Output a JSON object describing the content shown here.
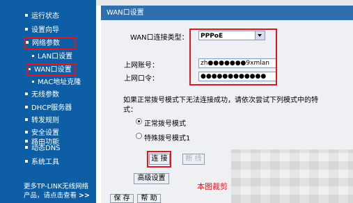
{
  "sidebar": {
    "items": [
      {
        "label": "运行状态",
        "level": "top"
      },
      {
        "label": "设置向导",
        "level": "top"
      },
      {
        "label": "网络参数",
        "level": "top",
        "highlighted": true
      },
      {
        "label": "LAN口设置",
        "level": "sub"
      },
      {
        "label": "WAN口设置",
        "level": "sub",
        "highlighted": true
      },
      {
        "label": "MAC地址克隆",
        "level": "sub"
      },
      {
        "label": "无线参数",
        "level": "top"
      },
      {
        "label": "DHCP服务器",
        "level": "top"
      },
      {
        "label": "转发规则",
        "level": "top"
      },
      {
        "label": "安全设置",
        "level": "top"
      },
      {
        "label": "路由功能",
        "level": "top"
      },
      {
        "label": "动态DNS",
        "level": "top"
      },
      {
        "label": "系统工具",
        "level": "top"
      }
    ],
    "promo_line1": "更多TP-LINK无线网络",
    "promo_line2": "产品，请点击查看",
    "promo_arrow": ">>"
  },
  "panel": {
    "title": "WAN口设置",
    "conn_type_label": "WAN口连接类型：",
    "conn_type_value": "PPPoE",
    "account_label": "上网账号：",
    "account_value": "zh●●●●●●●9xmlan",
    "password_label": "上网口令：",
    "password_value": "●●●●●●●●●●●●",
    "hint": "如果正常拨号模式下无法连接成功，请依次尝试下列模式中的特",
    "hint2": "式：",
    "mode_normal": "正常拨号模式",
    "mode_special": "特殊拨号模式1",
    "connect_button": "连 接",
    "disconnect_button": "断 线",
    "advanced_button": "高级设置",
    "save_button": "保 存",
    "help_button": "帮 助"
  },
  "watermark": "本图裁剪",
  "colors": {
    "sidebar_bg": "#0d5ea4",
    "title_bg": "#2f6fb0",
    "content_bg": "#eef0f4",
    "highlight": "#e8141c"
  }
}
